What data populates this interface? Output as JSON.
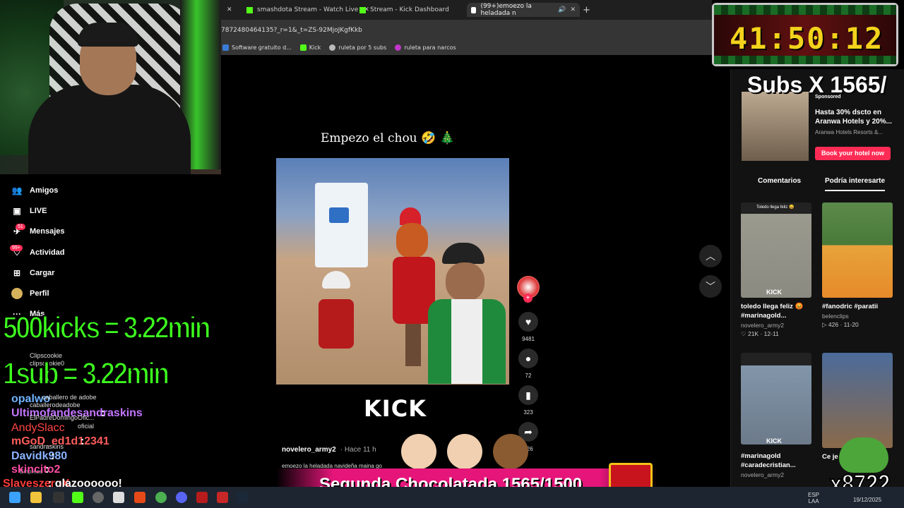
{
  "browser": {
    "tabs": [
      {
        "label": "smashdota Stream - Watch Live",
        "favicon_color": "#53fc18"
      },
      {
        "label": "Stream - Kick Dashboard",
        "favicon_color": "#53fc18"
      },
      {
        "label": "(99+)emoezo la heladada n",
        "favicon_color": "#ffffff"
      }
    ],
    "url": "7872480464135?_r=1&_t=ZS-92MjoJKgfKkb",
    "bookmarks": [
      {
        "label": "Software gratuito d...",
        "icon_color": "#3a7bd5"
      },
      {
        "label": "Kick",
        "icon_color": "#53fc18"
      },
      {
        "label": "ruleta por 5 subs",
        "icon_color": "#bbbbbb"
      },
      {
        "label": "ruleta para narcos",
        "icon_color": "#c236c9"
      }
    ]
  },
  "nav": {
    "items": [
      {
        "label": "Amigos",
        "icon": "users-icon"
      },
      {
        "label": "LIVE",
        "icon": "live-icon"
      },
      {
        "label": "Mensajes",
        "icon": "message-icon",
        "badge": "51"
      },
      {
        "label": "Actividad",
        "icon": "activity-icon",
        "badge": "99+"
      },
      {
        "label": "Cargar",
        "icon": "upload-icon"
      },
      {
        "label": "Perfil",
        "icon": "profile-icon"
      },
      {
        "label": "Más",
        "icon": "more-icon"
      }
    ]
  },
  "overlay": {
    "kicks_rate": "500kicks = 3.22min",
    "sub_rate": "1sub = 3.22min",
    "timer": "41:50:12",
    "subs_counter": "Subs X 1565/",
    "chocolatada": "Segunda Chocolatada 1565/1500",
    "kick_count": "x8722"
  },
  "chat": [
    {
      "user": "Clipscookie",
      "text": "",
      "color": "#dddddd"
    },
    {
      "user": "clipscookie0",
      "text": "",
      "color": "#dddddd"
    },
    {
      "user": "opalwo",
      "text": "caballero de adobe",
      "color": "#6fb3ff"
    },
    {
      "user": "",
      "text": "caballerodeadobe",
      "color": "#dddddd"
    },
    {
      "user": "Ultimofandesandraskins",
      "text": ":",
      "color": "#c275ff"
    },
    {
      "user": "",
      "text": "ElPadreDomingoOfic...",
      "color": "#dddddd"
    },
    {
      "user": "AndySlacc",
      "text": "oficial",
      "color": "#ff4444"
    },
    {
      "user": "mGoD_ed1d12341",
      "text": ":",
      "color": "#ff5c5c"
    },
    {
      "user": "",
      "text": "sandraskins",
      "color": "#dddddd"
    },
    {
      "user": "Davidk980",
      "text": ":",
      "color": "#8ab4ff"
    },
    {
      "user": "",
      "text": "Empresa",
      "color": "#dddddd"
    },
    {
      "user": "skincito2",
      "text": ":",
      "color": "#ff4da6"
    },
    {
      "user": "SlayeszeroX",
      "text": ": qlazoooooo!",
      "color": "#ff3b3b"
    }
  ],
  "video": {
    "caption": "Empezo el chou 🤣 🎄",
    "watermark": "KICK",
    "author": "novelero_army2",
    "time": "· Hace 11 h",
    "description": "emoezo la heladada navideña maina go",
    "actions": [
      {
        "icon": "heart-icon",
        "count": "9481"
      },
      {
        "icon": "comment-icon",
        "count": "72"
      },
      {
        "icon": "bookmark-icon",
        "count": "323"
      },
      {
        "icon": "share-icon",
        "count": "326"
      }
    ]
  },
  "ad": {
    "sponsored": "Sponsored",
    "title": "Hasta 30% dscto en Aranwa Hotels y 20%...",
    "advertiser": "Aranwa Hotels Resorts &...",
    "cta": "Book your hotel now"
  },
  "right_tabs": [
    "Comentarios",
    "Podría interesarte"
  ],
  "cards": [
    {
      "title": "toledo llega feliz 😡 #marinagold...",
      "user": "novelero_army2",
      "stats": "♡ 21K · 12-11",
      "thumb": "#8a8a80",
      "top_text": "Toledo llega feliz 😀",
      "watermark": "KICK"
    },
    {
      "title": "#fanodric #paratii",
      "user": "belenclips",
      "stats": "▷ 426 · 11-20",
      "thumb": "#5b8a4a",
      "top_text": "",
      "watermark": ""
    },
    {
      "title": "#marinagold #caradecristian...",
      "user": "novelero_army2",
      "stats": "",
      "thumb": "#6c7a8a",
      "top_text": "",
      "watermark": "KICK"
    },
    {
      "title": "Ce je veut",
      "user": "",
      "stats": "",
      "thumb": "#4b6b9a",
      "top_text": "",
      "watermark": ""
    }
  ],
  "taskbar": {
    "lang": "ESP",
    "lang2": "LAA",
    "time": "",
    "date": "19/12/2025"
  }
}
